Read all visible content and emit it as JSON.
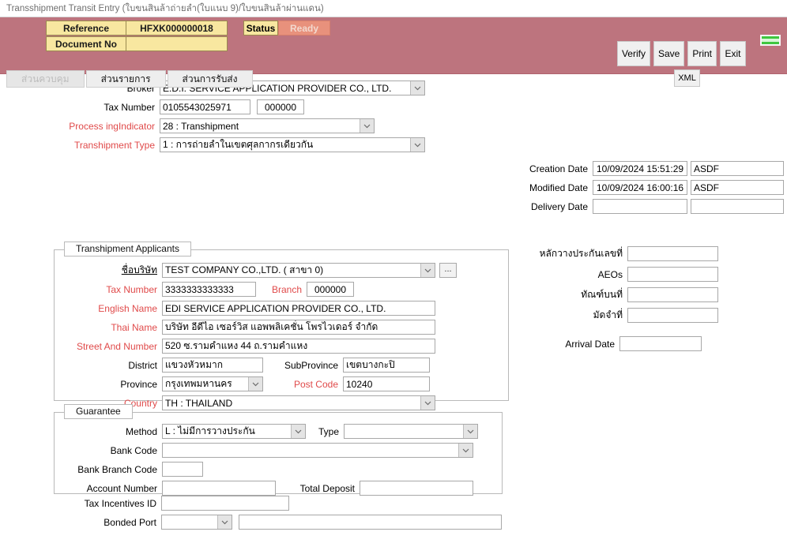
{
  "window": {
    "title": "Transshipment Transit Entry (ใบขนสินล้าถ่ายลำ(ใบแนบ 9)/ใบขนสินล้าผ่านแดน)"
  },
  "header": {
    "reference_label": "Reference",
    "reference_value": "HFXK000000018",
    "document_no_label": "Document No",
    "document_no_value": "",
    "status_label": "Status",
    "status_value": "Ready",
    "buttons": [
      "Verify",
      "Save",
      "Print",
      "Exit"
    ],
    "xml_button": "XML",
    "colors": {
      "band": "#bd747e",
      "field": "#f8e7a0",
      "status": "#e8917c",
      "led": "#3fc63f"
    }
  },
  "tabs": [
    {
      "label": "ส่วนควบคุม",
      "disabled": true
    },
    {
      "label": "ส่วนรายการ",
      "disabled": false
    },
    {
      "label": "ส่วนการรับส่ง",
      "disabled": false
    }
  ],
  "main": {
    "broker": {
      "label": "Broker",
      "value": "E.D.I. SERVICE APPLICATION PROVIDER CO., LTD."
    },
    "tax_number": {
      "label": "Tax Number",
      "value": "0105543025971",
      "branch_value": "000000"
    },
    "processing_indicator": {
      "label": "Process ingIndicator",
      "value": "28 : Transhipment"
    },
    "transhipment_type": {
      "label": "Transhipment Type",
      "value": "1 : การถ่ายลำในเขตศุลกากรเดียวกัน"
    }
  },
  "applicants": {
    "legend": "Transhipment Applicants",
    "company_name": {
      "label": "ชื่อบริษัท",
      "value": "TEST COMPANY CO.,LTD. ( สาขา 0)",
      "browse_label": "..."
    },
    "tax_number": {
      "label": "Tax Number",
      "value": "3333333333333"
    },
    "branch": {
      "label": "Branch",
      "value": "000000"
    },
    "english_name": {
      "label": "English Name",
      "value": "EDI SERVICE APPLICATION PROVIDER CO., LTD."
    },
    "thai_name": {
      "label": "Thai Name",
      "value": "บริษัท อีดีไอ เซอร์วิส แอพพลิเคชั่น โพรไวเดอร์ จำกัด"
    },
    "street_and_number": {
      "label": "Street And Number",
      "value": "520 ซ.รามคำแหง 44 ถ.รามคำแหง"
    },
    "district": {
      "label": "District",
      "value": "แขวงหัวหมาก"
    },
    "subprovince": {
      "label": "SubProvince",
      "value": "เขตบางกะปิ"
    },
    "province": {
      "label": "Province",
      "value": "กรุงเทพมหานคร"
    },
    "post_code": {
      "label": "Post Code",
      "value": "10240"
    },
    "country": {
      "label": "Country",
      "value": "TH : THAILAND"
    }
  },
  "guarantee": {
    "legend": "Guarantee",
    "method": {
      "label": "Method",
      "value": "L : ไม่มีการวางประกัน"
    },
    "type": {
      "label": "Type",
      "value": ""
    },
    "bank_code": {
      "label": "Bank Code",
      "value": ""
    },
    "bank_branch_code": {
      "label": "Bank Branch Code",
      "value": ""
    },
    "account_number": {
      "label": "Account Number",
      "value": ""
    },
    "total_deposit": {
      "label": "Total Deposit",
      "value": ""
    }
  },
  "bottom": {
    "tax_incentives_id": {
      "label": "Tax Incentives ID",
      "value": ""
    },
    "bonded_port": {
      "label": "Bonded Port",
      "value": "",
      "description_value": ""
    }
  },
  "right": {
    "creation_date": {
      "label": "Creation Date",
      "value": "10/09/2024 15:51:29",
      "user_value": "ASDF"
    },
    "modified_date": {
      "label": "Modified Date",
      "value": "10/09/2024 16:00:16",
      "user_value": "ASDF"
    },
    "delivery_date": {
      "label": "Delivery Date",
      "value": "",
      "user_value": ""
    },
    "guarantee_no": {
      "label": "หลักวางประกันเลขที่",
      "value": ""
    },
    "aeos": {
      "label": "AEOs",
      "value": ""
    },
    "bonded_warehouse_no": {
      "label": "ทัณฑ์บนที่",
      "value": ""
    },
    "pledge_no": {
      "label": "มัดจำที่",
      "value": ""
    },
    "arrival_date": {
      "label": "Arrival Date",
      "value": ""
    }
  }
}
